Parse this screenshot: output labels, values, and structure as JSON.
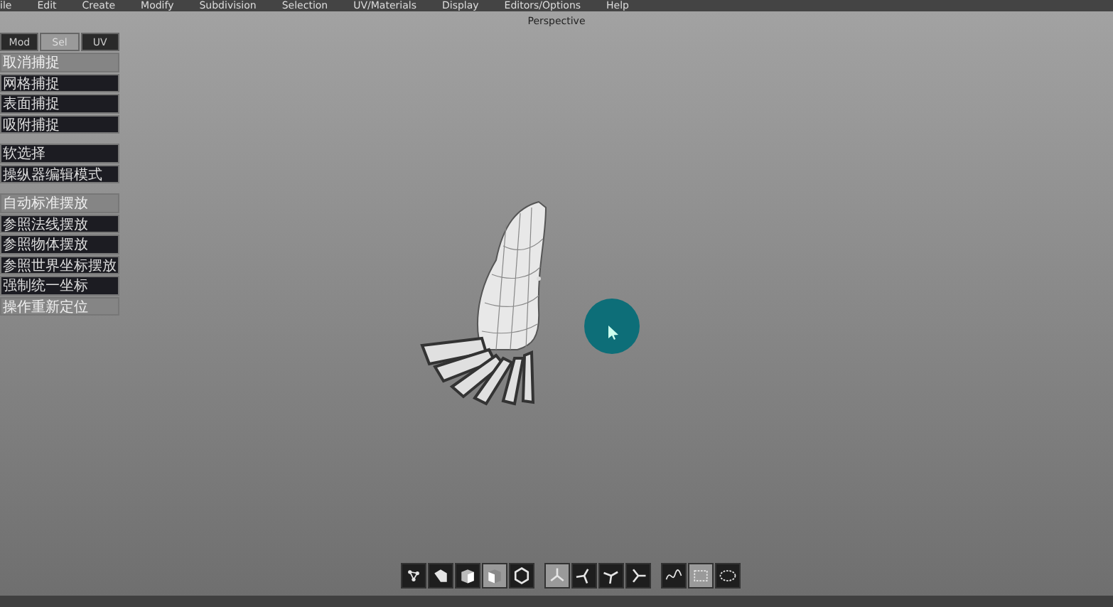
{
  "menu_bar": [
    "ile",
    "Edit",
    "Create",
    "Modify",
    "Subdivision",
    "Selection",
    "UV/Materials",
    "Display",
    "Editors/Options",
    "Help"
  ],
  "viewport": {
    "label": "Perspective"
  },
  "side_panel": {
    "tabs": [
      {
        "label": "Mod",
        "selected": false
      },
      {
        "label": "Sel",
        "selected": true
      },
      {
        "label": "UV",
        "selected": false
      }
    ],
    "groups": [
      [
        {
          "label": "取消捕捉",
          "selected": true
        },
        {
          "label": "网格捕捉",
          "selected": false
        },
        {
          "label": "表面捕捉",
          "selected": false
        },
        {
          "label": "吸附捕捉",
          "selected": false
        }
      ],
      [
        {
          "label": "软选择",
          "selected": false
        },
        {
          "label": "操纵器编辑模式",
          "selected": false
        }
      ],
      [
        {
          "label": "自动标准摆放",
          "selected": true
        },
        {
          "label": "参照法线摆放",
          "selected": false
        },
        {
          "label": "参照物体摆放",
          "selected": false
        },
        {
          "label": "参照世界坐标摆放",
          "selected": false
        },
        {
          "label": "强制统一坐标",
          "selected": false
        },
        {
          "label": "操作重新定位",
          "selected": true
        }
      ]
    ]
  },
  "toolbar": [
    [
      {
        "selected": false
      },
      {
        "selected": false
      },
      {
        "selected": false
      },
      {
        "selected": true
      },
      {
        "selected": false
      }
    ],
    [
      {
        "selected": true
      },
      {
        "selected": false
      },
      {
        "selected": false
      },
      {
        "selected": false
      }
    ],
    [
      {
        "selected": false
      },
      {
        "selected": true
      },
      {
        "selected": false
      }
    ]
  ]
}
